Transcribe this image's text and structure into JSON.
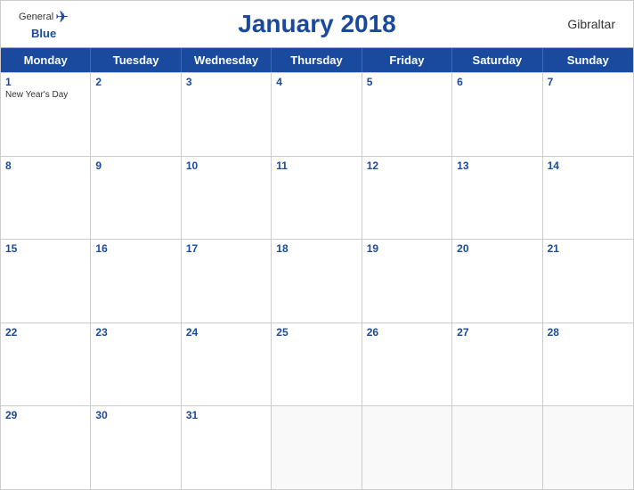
{
  "header": {
    "title": "January 2018",
    "region": "Gibraltar",
    "logo_general": "General",
    "logo_blue": "Blue"
  },
  "dayHeaders": [
    "Monday",
    "Tuesday",
    "Wednesday",
    "Thursday",
    "Friday",
    "Saturday",
    "Sunday"
  ],
  "weeks": [
    [
      {
        "day": 1,
        "holiday": "New Year's Day"
      },
      {
        "day": 2
      },
      {
        "day": 3
      },
      {
        "day": 4
      },
      {
        "day": 5
      },
      {
        "day": 6
      },
      {
        "day": 7
      }
    ],
    [
      {
        "day": 8
      },
      {
        "day": 9
      },
      {
        "day": 10
      },
      {
        "day": 11
      },
      {
        "day": 12
      },
      {
        "day": 13
      },
      {
        "day": 14
      }
    ],
    [
      {
        "day": 15
      },
      {
        "day": 16
      },
      {
        "day": 17
      },
      {
        "day": 18
      },
      {
        "day": 19
      },
      {
        "day": 20
      },
      {
        "day": 21
      }
    ],
    [
      {
        "day": 22
      },
      {
        "day": 23
      },
      {
        "day": 24
      },
      {
        "day": 25
      },
      {
        "day": 26
      },
      {
        "day": 27
      },
      {
        "day": 28
      }
    ],
    [
      {
        "day": 29
      },
      {
        "day": 30
      },
      {
        "day": 31
      },
      {
        "day": null
      },
      {
        "day": null
      },
      {
        "day": null
      },
      {
        "day": null
      }
    ]
  ]
}
